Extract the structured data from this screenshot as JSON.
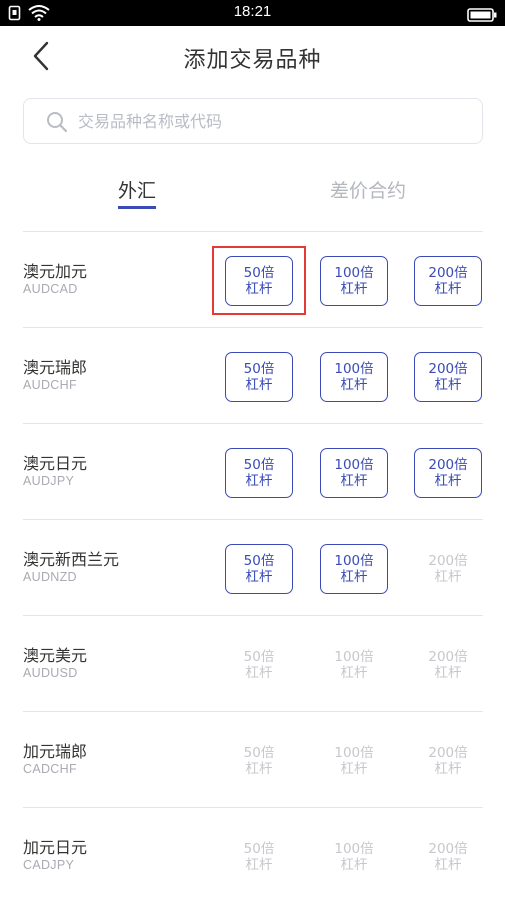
{
  "status_bar": {
    "time": "18:21"
  },
  "header": {
    "title": "添加交易品种"
  },
  "search": {
    "placeholder": "交易品种名称或代码"
  },
  "tabs": [
    {
      "label": "外汇",
      "active": true
    },
    {
      "label": "差价合约",
      "active": false
    }
  ],
  "colors": {
    "accent": "#3a4bb8",
    "disabled": "#c6c8cd",
    "highlight": "#e53935"
  },
  "instruments": [
    {
      "name": "澳元加元",
      "code": "AUDCAD",
      "leverage": [
        {
          "line1": "50倍",
          "line2": "杠杆",
          "enabled": true
        },
        {
          "line1": "100倍",
          "line2": "杠杆",
          "enabled": true
        },
        {
          "line1": "200倍",
          "line2": "杠杆",
          "enabled": true
        }
      ]
    },
    {
      "name": "澳元瑞郎",
      "code": "AUDCHF",
      "leverage": [
        {
          "line1": "50倍",
          "line2": "杠杆",
          "enabled": true
        },
        {
          "line1": "100倍",
          "line2": "杠杆",
          "enabled": true
        },
        {
          "line1": "200倍",
          "line2": "杠杆",
          "enabled": true
        }
      ]
    },
    {
      "name": "澳元日元",
      "code": "AUDJPY",
      "leverage": [
        {
          "line1": "50倍",
          "line2": "杠杆",
          "enabled": true
        },
        {
          "line1": "100倍",
          "line2": "杠杆",
          "enabled": true
        },
        {
          "line1": "200倍",
          "line2": "杠杆",
          "enabled": true
        }
      ]
    },
    {
      "name": "澳元新西兰元",
      "code": "AUDNZD",
      "leverage": [
        {
          "line1": "50倍",
          "line2": "杠杆",
          "enabled": true
        },
        {
          "line1": "100倍",
          "line2": "杠杆",
          "enabled": true
        },
        {
          "line1": "200倍",
          "line2": "杠杆",
          "enabled": false
        }
      ]
    },
    {
      "name": "澳元美元",
      "code": "AUDUSD",
      "leverage": [
        {
          "line1": "50倍",
          "line2": "杠杆",
          "enabled": false
        },
        {
          "line1": "100倍",
          "line2": "杠杆",
          "enabled": false
        },
        {
          "line1": "200倍",
          "line2": "杠杆",
          "enabled": false
        }
      ]
    },
    {
      "name": "加元瑞郎",
      "code": "CADCHF",
      "leverage": [
        {
          "line1": "50倍",
          "line2": "杠杆",
          "enabled": false
        },
        {
          "line1": "100倍",
          "line2": "杠杆",
          "enabled": false
        },
        {
          "line1": "200倍",
          "line2": "杠杆",
          "enabled": false
        }
      ]
    },
    {
      "name": "加元日元",
      "code": "CADJPY",
      "leverage": [
        {
          "line1": "50倍",
          "line2": "杠杆",
          "enabled": false
        },
        {
          "line1": "100倍",
          "line2": "杠杆",
          "enabled": false
        },
        {
          "line1": "200倍",
          "line2": "杠杆",
          "enabled": false
        }
      ]
    }
  ]
}
